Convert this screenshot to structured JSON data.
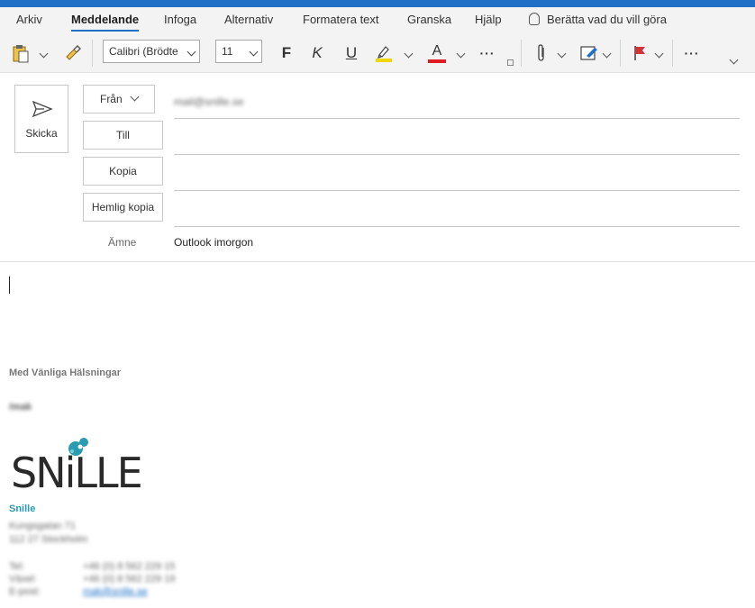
{
  "tabs": [
    "Arkiv",
    "Meddelande",
    "Infoga",
    "Alternativ",
    "Formatera text",
    "Granska",
    "Hjälp"
  ],
  "active_tab": "Meddelande",
  "tell_me": "Berätta vad du vill göra",
  "font_name": "Calibri (Brödte",
  "font_size": "11",
  "format_labels": {
    "bold": "F",
    "italic": "K",
    "underline": "U",
    "font_color": "A",
    "more": "···"
  },
  "colors": {
    "accent": "#1e6fc5",
    "highlight": "#f2d600",
    "font_color": "#e11b22",
    "flag": "#d13438",
    "company": "#2a9bb0"
  },
  "compose": {
    "send_label": "Skicka",
    "from_label": "Från",
    "from_value": "mail@snille.se",
    "to_label": "Till",
    "cc_label": "Kopia",
    "bcc_label": "Hemlig kopia",
    "subject_label": "Ämne",
    "subject_value": "Outlook imorgon"
  },
  "body": {
    "greeting": "Med Vänliga Hälsningar",
    "name": "/mak",
    "logo_text": "SNiLLE",
    "company": "Snille",
    "address_line1": "Kungsgatan 71",
    "address_line2": "112 27 Stockholm",
    "contacts": [
      {
        "label": "Tel:",
        "value": "+46 (0) 8 562 229 15"
      },
      {
        "label": "Växel:",
        "value": "+46 (0) 8 562 229 19"
      },
      {
        "label": "E-post:",
        "value": "mak@snille.se"
      }
    ]
  }
}
